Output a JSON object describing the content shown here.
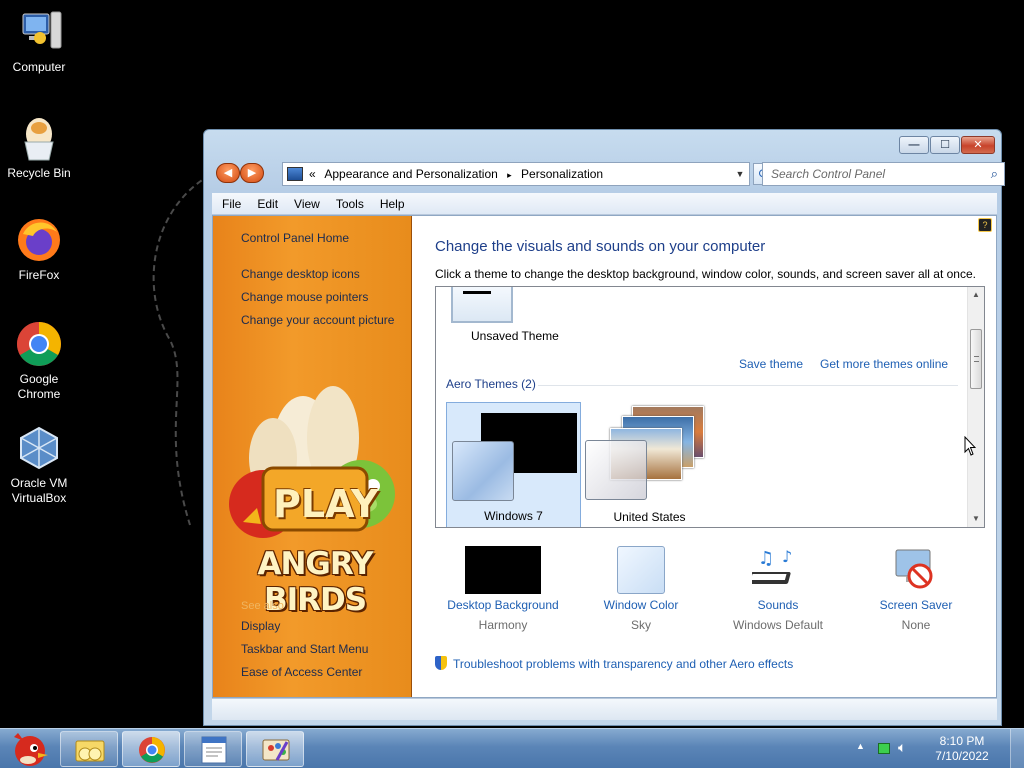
{
  "desktop": {
    "icons": [
      {
        "label_line1": "Computer",
        "label_line2": "",
        "icon": "computer-icon"
      },
      {
        "label_line1": "Recycle Bin",
        "label_line2": "",
        "icon": "recycle-bin-icon"
      },
      {
        "label_line1": "FireFox",
        "label_line2": "",
        "icon": "firefox-icon"
      },
      {
        "label_line1": "Google",
        "label_line2": "Chrome",
        "icon": "chrome-icon"
      },
      {
        "label_line1": "Oracle VM",
        "label_line2": "VirtualBox",
        "icon": "virtualbox-icon"
      }
    ]
  },
  "window": {
    "breadcrumb": [
      "«",
      "Appearance and Personalization",
      "▸",
      "Personalization"
    ],
    "search_placeholder": "Search Control Panel",
    "menu": [
      "File",
      "Edit",
      "View",
      "Tools",
      "Help"
    ],
    "caption": {
      "minimize": "—",
      "maximize": "☐",
      "close": "✕"
    },
    "nav": {
      "back": "◀",
      "forward": "▶"
    }
  },
  "sidebar": {
    "links": [
      "Control Panel Home",
      "Change desktop icons",
      "Change mouse pointers",
      "Change your account picture"
    ],
    "see_also_heading": "See also",
    "see_also": [
      "Display",
      "Taskbar and Start Menu",
      "Ease of Access Center"
    ],
    "banner_play": "PLAY",
    "banner_title": "ANGRY BIRDS"
  },
  "main": {
    "heading": "Change the visuals and sounds on your computer",
    "subheading": "Click a theme to change the desktop background, window color, sounds, and screen saver all at once.",
    "unsaved_theme": "Unsaved Theme",
    "save_theme": "Save theme",
    "more_themes": "Get more themes online",
    "aero_heading": "Aero Themes (2)",
    "themes": [
      {
        "name": "Windows 7",
        "selected": true
      },
      {
        "name": "United States",
        "selected": false
      }
    ],
    "options": [
      {
        "title": "Desktop Background",
        "value": "Harmony"
      },
      {
        "title": "Window Color",
        "value": "Sky"
      },
      {
        "title": "Sounds",
        "value": "Windows Default"
      },
      {
        "title": "Screen Saver",
        "value": "None"
      }
    ],
    "troubleshoot": "Troubleshoot problems with transparency and other Aero effects"
  },
  "taskbar": {
    "time": "8:10 PM",
    "date": "7/10/2022",
    "buttons": [
      "angry-birds-start",
      "explorer",
      "chrome",
      "wordpad",
      "personalization"
    ]
  },
  "colors": {
    "link": "#1e5fb3",
    "heading": "#1e3f8a",
    "sidebar_orange": "#f29a2a",
    "taskbar": "#5b85b7"
  }
}
